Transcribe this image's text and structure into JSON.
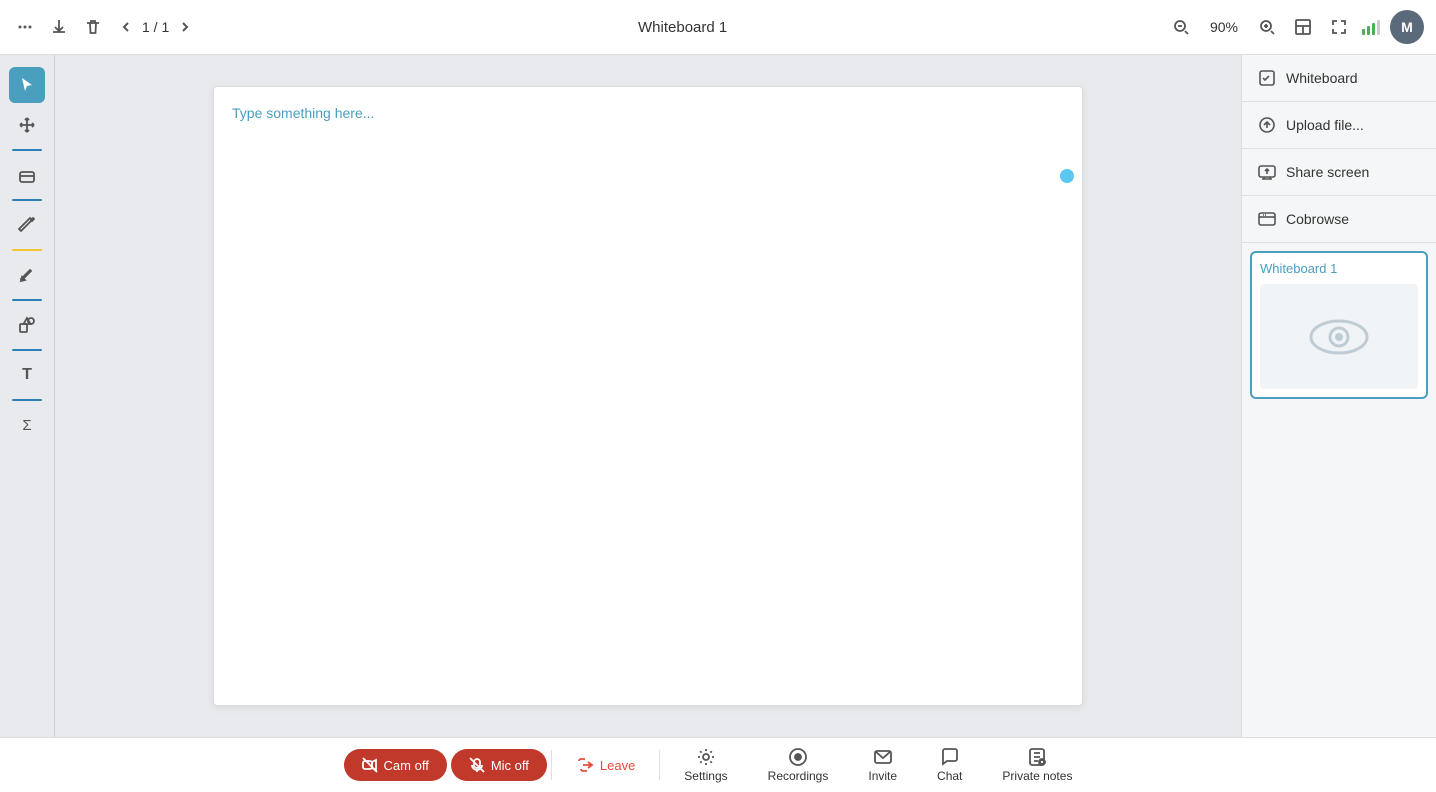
{
  "topbar": {
    "more_icon": "⋮",
    "download_icon": "⬇",
    "delete_icon": "🗑",
    "prev_icon": "‹",
    "next_icon": "›",
    "page_current": "1",
    "page_separator": "/",
    "page_total": "1",
    "title": "Whiteboard 1",
    "zoom_out_icon": "🔍",
    "zoom_level": "90%",
    "zoom_in_icon": "🔍",
    "layout_icon": "▣",
    "fullscreen_icon": "⛶",
    "avatar_label": "M"
  },
  "toolbar": {
    "tools": [
      {
        "name": "select",
        "icon": "↖",
        "active": true
      },
      {
        "name": "move",
        "icon": "✥",
        "active": false
      },
      {
        "name": "eraser",
        "icon": "◻",
        "active": false
      },
      {
        "name": "pen",
        "icon": "✏",
        "active": false
      },
      {
        "name": "highlight",
        "icon": "✒",
        "active": false
      },
      {
        "name": "shapes",
        "icon": "⌂",
        "active": false
      },
      {
        "name": "text",
        "icon": "T",
        "active": false
      },
      {
        "name": "formula",
        "icon": "Σ",
        "active": false
      }
    ]
  },
  "canvas": {
    "placeholder": "Type something here..."
  },
  "right_panel": {
    "items": [
      {
        "label": "Whiteboard",
        "icon": "whiteboard"
      },
      {
        "label": "Upload file...",
        "icon": "upload"
      },
      {
        "label": "Share screen",
        "icon": "share-screen"
      },
      {
        "label": "Cobrowse",
        "icon": "cobrowse"
      }
    ],
    "whiteboard_thumb": {
      "title": "Whiteboard 1"
    }
  },
  "bottom_bar": {
    "buttons": [
      {
        "label": "Cam off",
        "type": "danger",
        "icon": "cam"
      },
      {
        "label": "Mic off",
        "type": "danger",
        "icon": "mic"
      },
      {
        "label": "Leave",
        "type": "leave",
        "icon": "phone"
      },
      {
        "label": "Settings",
        "type": "normal",
        "icon": "settings"
      },
      {
        "label": "Recordings",
        "type": "normal",
        "icon": "recordings"
      },
      {
        "label": "Invite",
        "type": "normal",
        "icon": "invite"
      },
      {
        "label": "Chat",
        "type": "normal",
        "icon": "chat"
      },
      {
        "label": "Private notes",
        "type": "normal",
        "icon": "notes"
      }
    ]
  }
}
